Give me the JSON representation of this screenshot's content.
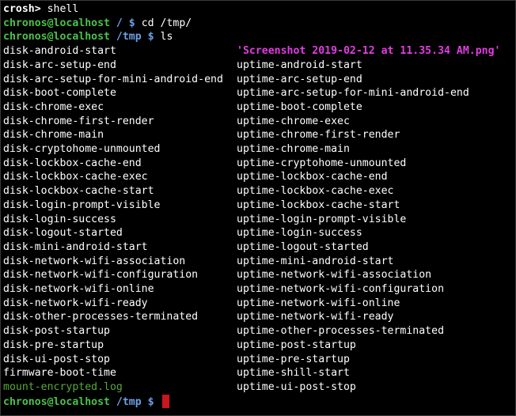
{
  "colors": {
    "background": "#000000",
    "text": "#ffffff",
    "crosh_prompt": "#ffffff",
    "user_host": "#4ac24a",
    "path": "#6aa0e6",
    "quoted_file": "#e23ce2",
    "log_file": "#58a83a",
    "cursor": "#c8171e"
  },
  "crosh": {
    "prompt": "crosh>",
    "command": " shell"
  },
  "commands": [
    {
      "user_host": "chronos@localhost",
      "path": " / $ ",
      "command": "cd /tmp/"
    },
    {
      "user_host": "chronos@localhost",
      "path": " /tmp $ ",
      "command": "ls"
    }
  ],
  "listing": {
    "left": [
      "disk-android-start",
      "disk-arc-setup-end",
      "disk-arc-setup-for-mini-android-end",
      "disk-boot-complete",
      "disk-chrome-exec",
      "disk-chrome-first-render",
      "disk-chrome-main",
      "disk-cryptohome-unmounted",
      "disk-lockbox-cache-end",
      "disk-lockbox-cache-exec",
      "disk-lockbox-cache-start",
      "disk-login-prompt-visible",
      "disk-login-success",
      "disk-logout-started",
      "disk-mini-android-start",
      "disk-network-wifi-association",
      "disk-network-wifi-configuration",
      "disk-network-wifi-online",
      "disk-network-wifi-ready",
      "disk-other-processes-terminated",
      "disk-post-startup",
      "disk-pre-startup",
      "disk-ui-post-stop",
      "firmware-boot-time",
      "mount-encrypted.log"
    ],
    "right": [
      "'Screenshot 2019-02-12 at 11.35.34 AM.png'",
      "uptime-android-start",
      "uptime-arc-setup-end",
      "uptime-arc-setup-for-mini-android-end",
      "uptime-boot-complete",
      "uptime-chrome-exec",
      "uptime-chrome-first-render",
      "uptime-chrome-main",
      "uptime-cryptohome-unmounted",
      "uptime-lockbox-cache-end",
      "uptime-lockbox-cache-exec",
      "uptime-lockbox-cache-start",
      "uptime-login-prompt-visible",
      "uptime-login-success",
      "uptime-logout-started",
      "uptime-mini-android-start",
      "uptime-network-wifi-association",
      "uptime-network-wifi-configuration",
      "uptime-network-wifi-online",
      "uptime-network-wifi-ready",
      "uptime-other-processes-terminated",
      "uptime-post-startup",
      "uptime-pre-startup",
      "uptime-shill-start",
      "uptime-ui-post-stop"
    ]
  },
  "final_prompt": {
    "user_host": "chronos@localhost",
    "path": " /tmp $ "
  }
}
